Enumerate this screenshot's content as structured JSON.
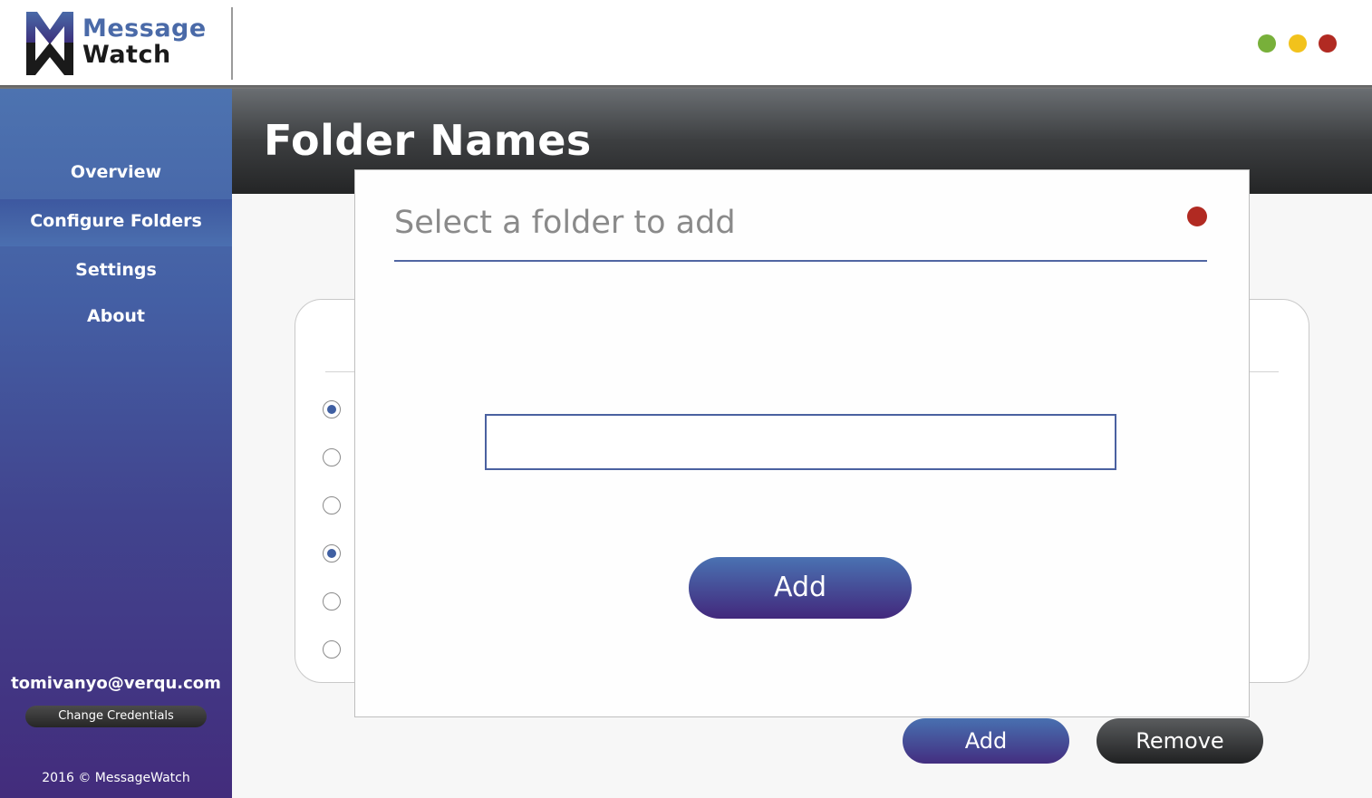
{
  "app": {
    "logo_line1": "Message",
    "logo_line2": "Watch",
    "window_controls": {
      "minimize_color": "#78b03a",
      "maximize_color": "#f2c21c",
      "close_color": "#b12a22"
    }
  },
  "sidebar": {
    "items": [
      {
        "label": "Overview"
      },
      {
        "label": "Configure Folders",
        "active": true
      },
      {
        "label": "Settings"
      },
      {
        "label": "About"
      }
    ],
    "user_email": "tomivanyo@verqu.com",
    "change_credentials_label": "Change Credentials",
    "copyright": "2016 © MessageWatch"
  },
  "main": {
    "title": "Folder Names",
    "radios": [
      {
        "checked": true
      },
      {
        "checked": false
      },
      {
        "checked": false
      },
      {
        "checked": true
      },
      {
        "checked": false
      },
      {
        "checked": false
      }
    ],
    "add_label": "Add",
    "remove_label": "Remove"
  },
  "modal": {
    "title": "Select a folder to add",
    "input_value": "",
    "add_label": "Add"
  },
  "colors": {
    "accent_blue": "#4a6aa8",
    "accent_purple": "#432c7c",
    "close_red": "#b12a22"
  }
}
